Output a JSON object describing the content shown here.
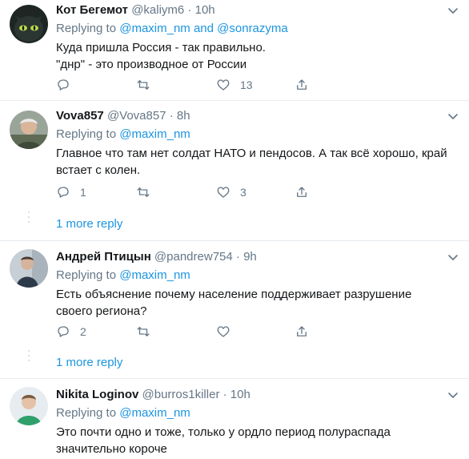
{
  "tweets": [
    {
      "name": "Кот Бегемот",
      "handle": "@kaliym6",
      "dot": "·",
      "time": "10h",
      "replying_prefix": "Replying to ",
      "replying_links": "@maxim_nm and @sonrazyma",
      "text_lines": [
        "Куда пришла Россия - так правильно.",
        "\"днр\" - это производное от России"
      ],
      "reply_count": "",
      "retweet_count": "",
      "like_count": "13",
      "avatar_icon": "cat-avatar"
    },
    {
      "name": "Vova857",
      "handle": "@Vova857",
      "dot": "·",
      "time": "8h",
      "replying_prefix": "Replying to ",
      "replying_links": "@maxim_nm",
      "text_lines": [
        "Главное что там нет солдат НАТО и пендосов. А так всё хорошо, край",
        "встает с колен."
      ],
      "reply_count": "1",
      "retweet_count": "",
      "like_count": "3",
      "avatar_icon": "person-avatar"
    },
    {
      "name": "Андрей Птицын",
      "handle": "@pandrew754",
      "dot": "·",
      "time": "9h",
      "replying_prefix": "Replying to ",
      "replying_links": "@maxim_nm",
      "text_lines": [
        "Есть объяснение почему население поддерживает разрушение",
        "своего региона?"
      ],
      "reply_count": "2",
      "retweet_count": "",
      "like_count": "",
      "avatar_icon": "person-avatar"
    },
    {
      "name": "Nikita Loginov",
      "handle": "@burros1killer",
      "dot": "·",
      "time": "10h",
      "replying_prefix": "Replying to ",
      "replying_links": "@maxim_nm",
      "text_lines": [
        "Это почти одно и тоже, только у ордло период полураспада",
        "значительно короче"
      ],
      "avatar_icon": "person-avatar"
    }
  ],
  "more_replies": [
    {
      "label": "1 more reply"
    },
    {
      "label": "1 more reply"
    }
  ],
  "colors": {
    "accent": "#1b95e0",
    "secondary_text": "#657786",
    "divider": "#e6ecf0"
  }
}
